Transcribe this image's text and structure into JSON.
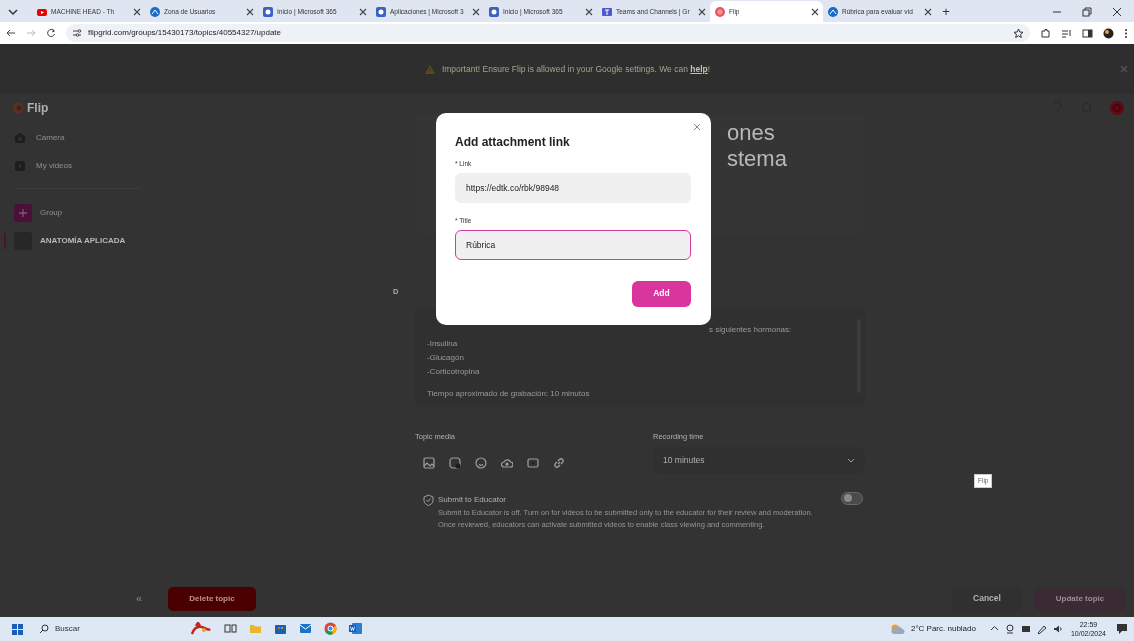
{
  "browser": {
    "tabs": [
      {
        "title": "MACHINE HEAD - Th",
        "kind": "youtube",
        "selected": false
      },
      {
        "title": "Zona de Usuarios",
        "kind": "site",
        "selected": false
      },
      {
        "title": "Inicio | Microsoft 365",
        "kind": "office",
        "selected": false
      },
      {
        "title": "Aplicaciones | Microsoft 3",
        "kind": "office",
        "selected": false
      },
      {
        "title": "Inicio | Microsoft 365",
        "kind": "office",
        "selected": false
      },
      {
        "title": "Teams and Channels | Gr",
        "kind": "teams",
        "selected": false
      },
      {
        "title": "Flip",
        "kind": "flip",
        "selected": true
      },
      {
        "title": "Rúbrica para evaluar víd",
        "kind": "site",
        "selected": false
      }
    ],
    "new_tab": "+",
    "url": "flipgrid.com/groups/15430173/topics/40554327/update"
  },
  "banner": {
    "message": "Important! Ensure Flip is allowed in your Google settings. We can ",
    "link": "help",
    "suffix": "!"
  },
  "app": {
    "logo": "Flip"
  },
  "sidebar": {
    "items": [
      {
        "label": "Camera",
        "kind": "camera"
      },
      {
        "label": "My videos",
        "kind": "videos"
      }
    ],
    "groups": [
      {
        "label": "Group",
        "kind": "add",
        "selected": false
      },
      {
        "label": "ANATOMÍA APLICADA",
        "kind": "group",
        "selected": true
      }
    ]
  },
  "topic": {
    "heading": [
      "ones",
      "stema"
    ],
    "description_label": "D",
    "paragraphs": [
      [
        "s siguientes hormonas:",
        "-Insulina",
        "-Glucagón",
        "-Corticotropina"
      ],
      [
        "Tiempo aproximado de grabación: 10 minutos"
      ]
    ]
  },
  "media": {
    "label": "Topic media"
  },
  "recording": {
    "label": "Recording time",
    "value": "10 minutes"
  },
  "submit": {
    "title": "Submit to Educator",
    "text": "Submit to Educator is off. Turn on for videos to be submitted only to the educator for their review and moderation. Once reviewed, educators can activate submitted videos to enable class viewing and commenting.",
    "on": false
  },
  "tooltip": "Flip",
  "footer": {
    "collapse": "«",
    "delete": "Delete topic",
    "cancel": "Cancel",
    "update": "Update topic",
    "update_disabled": true
  },
  "modal": {
    "title": "Add attachment link",
    "fields": [
      {
        "label": "* Link",
        "value": "https://edtk.co/rbk/98948",
        "focused": false
      },
      {
        "label": "* Title",
        "value": "Rúbrica",
        "focused": true
      }
    ],
    "submit": "Add"
  },
  "taskbar": {
    "search": "Buscar",
    "weather": "2°C Parc. nublado",
    "time": "22:59",
    "date": "10/02/2024"
  }
}
